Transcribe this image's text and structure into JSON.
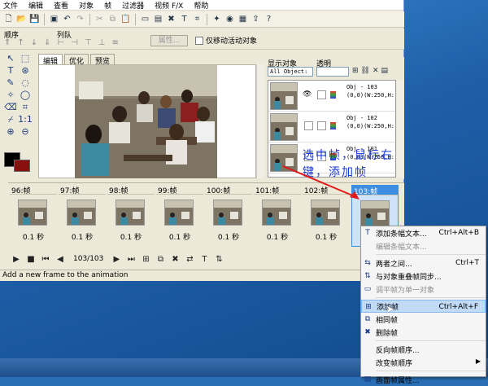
{
  "menubar": [
    "文件",
    "编辑",
    "查看",
    "对象",
    "帧",
    "过滤器",
    "视频 F/X",
    "帮助"
  ],
  "row2": {
    "order_label": "顺序",
    "align_label": "列队",
    "props_button": "属性...",
    "only_move_active": "仅移动活动对象"
  },
  "tabs": [
    "编辑",
    "优化",
    "预览"
  ],
  "right_panel": {
    "show_objects_label": "显示对象",
    "opacity_label": "透明",
    "filter_value": "All Object:",
    "objects": [
      {
        "name": "Obj - 103",
        "coords": "(0,0)(W:250,H:"
      },
      {
        "name": "Obj - 102",
        "coords": "(0,0)(W:250,H:"
      },
      {
        "name": "Obj - 101",
        "coords": "(0,0)(W:250,H:"
      }
    ]
  },
  "annotation": "选中帧，鼠标右键，添加帧",
  "frames": [
    {
      "label": "96:帧",
      "delay": "0.1 秒"
    },
    {
      "label": "97:帧",
      "delay": "0.1 秒"
    },
    {
      "label": "98:帧",
      "delay": "0.1 秒"
    },
    {
      "label": "99:帧",
      "delay": "0.1 秒"
    },
    {
      "label": "100:帧",
      "delay": "0.1 秒"
    },
    {
      "label": "101:帧",
      "delay": "0.1 秒"
    },
    {
      "label": "102:帧",
      "delay": "0.1 秒"
    },
    {
      "label": "103:帧",
      "delay": ""
    }
  ],
  "playback": {
    "position": "103/103"
  },
  "status_text": "Add a new frame to the animation",
  "context_menu": [
    {
      "label": "添加条幅文本...",
      "shortcut": "Ctrl+Alt+B",
      "icon": "text-icon",
      "disabled": false
    },
    {
      "label": "编辑条幅文本...",
      "shortcut": "",
      "icon": "",
      "disabled": true
    },
    {
      "sep": true
    },
    {
      "label": "两者之间...",
      "shortcut": "Ctrl+T",
      "icon": "tween-icon",
      "disabled": false
    },
    {
      "label": "与对象重叠帧同步...",
      "shortcut": "",
      "icon": "sync-icon",
      "disabled": false
    },
    {
      "label": "调平帧为单一对象",
      "shortcut": "",
      "icon": "flatten-icon",
      "disabled": true
    },
    {
      "sep": true
    },
    {
      "label": "添加帧",
      "shortcut": "Ctrl+Alt+F",
      "icon": "add-frame-icon",
      "disabled": false,
      "highlight": true
    },
    {
      "label": "相同帧",
      "shortcut": "",
      "icon": "duplicate-icon",
      "disabled": false
    },
    {
      "label": "删除帧",
      "shortcut": "",
      "icon": "delete-icon",
      "disabled": false
    },
    {
      "sep": true
    },
    {
      "label": "反向帧顺序...",
      "shortcut": "",
      "icon": "",
      "disabled": false
    },
    {
      "label": "改变帧顺序",
      "shortcut": "",
      "icon": "",
      "disabled": false,
      "submenu": true
    },
    {
      "sep": true
    },
    {
      "label": "画面帧属性...",
      "shortcut": "",
      "icon": "props-icon",
      "disabled": false
    }
  ]
}
